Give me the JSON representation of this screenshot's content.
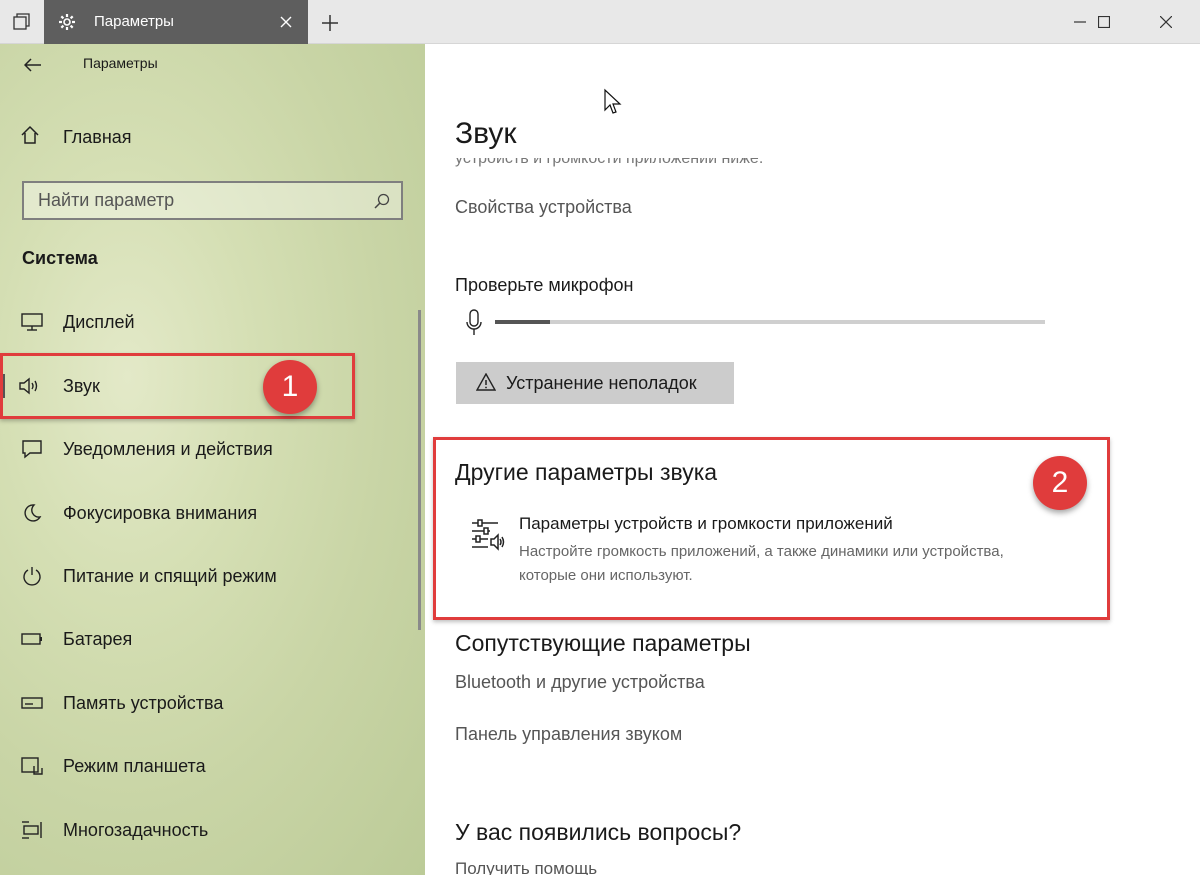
{
  "window": {
    "tab_title": "Параметры"
  },
  "sidebar": {
    "app_title": "Параметры",
    "home_label": "Главная",
    "search_placeholder": "Найти параметр",
    "section_title": "Система",
    "items": [
      {
        "label": "Дисплей",
        "icon": "monitor-icon"
      },
      {
        "label": "Звук",
        "icon": "speaker-icon",
        "active": true
      },
      {
        "label": "Уведомления и действия",
        "icon": "notification-icon"
      },
      {
        "label": "Фокусировка внимания",
        "icon": "moon-icon"
      },
      {
        "label": "Питание и спящий режим",
        "icon": "power-icon"
      },
      {
        "label": "Батарея",
        "icon": "battery-icon"
      },
      {
        "label": "Память устройства",
        "icon": "storage-icon"
      },
      {
        "label": "Режим планшета",
        "icon": "tablet-icon"
      },
      {
        "label": "Многозадачность",
        "icon": "multitask-icon"
      }
    ]
  },
  "annotations": {
    "badge_1": "1",
    "badge_2": "2"
  },
  "main": {
    "title": "Звук",
    "clipped_text": "устройств и громкости приложений ниже.",
    "device_properties_link": "Свойства устройства",
    "mic_test_label": "Проверьте микрофон",
    "mic_level": 0.1,
    "troubleshoot_label": "Устранение неполадок",
    "other_section_title": "Другие параметры звука",
    "app_volume": {
      "title": "Параметры устройств и громкости приложений",
      "description": "Настройте громкость приложений, а также динамики или устройства, которые они используют."
    },
    "related_section_title": "Сопутствующие параметры",
    "bluetooth_link": "Bluetooth и другие устройства",
    "sound_panel_link": "Панель управления звуком",
    "help_section_title": "У вас появились вопросы?",
    "get_help_link": "Получить помощь"
  },
  "colors": {
    "annotation_red": "#e03c3c",
    "tab_dark": "#5e5e5e"
  }
}
